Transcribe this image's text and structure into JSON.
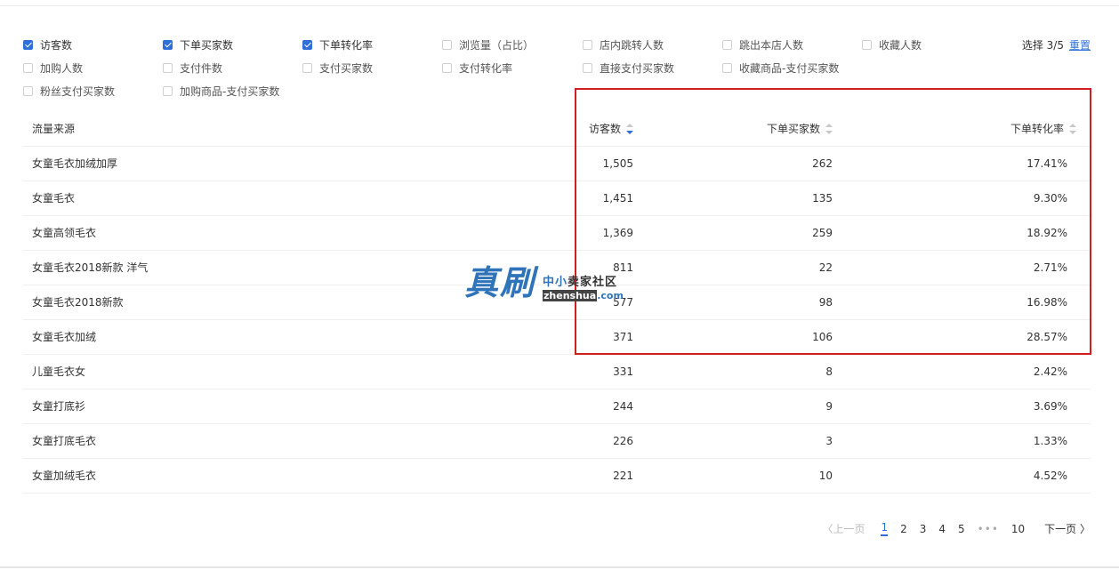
{
  "filters": {
    "row1": [
      {
        "label": "访客数",
        "checked": true
      },
      {
        "label": "下单买家数",
        "checked": true
      },
      {
        "label": "下单转化率",
        "checked": true
      },
      {
        "label": "浏览量（占比）",
        "checked": false
      },
      {
        "label": "店内跳转人数",
        "checked": false
      },
      {
        "label": "跳出本店人数",
        "checked": false
      },
      {
        "label": "收藏人数",
        "checked": false
      }
    ],
    "row2": [
      {
        "label": "加购人数",
        "checked": false
      },
      {
        "label": "支付件数",
        "checked": false
      },
      {
        "label": "支付买家数",
        "checked": false
      },
      {
        "label": "支付转化率",
        "checked": false
      },
      {
        "label": "直接支付买家数",
        "checked": false
      },
      {
        "label": "收藏商品-支付买家数",
        "checked": false
      }
    ],
    "row3": [
      {
        "label": "粉丝支付买家数",
        "checked": false
      },
      {
        "label": "加购商品-支付买家数",
        "checked": false
      }
    ],
    "selection_text": "选择 3/5",
    "reset_label": "重置"
  },
  "table": {
    "headers": {
      "source": "流量来源",
      "visitors": "访客数",
      "buyers": "下单买家数",
      "rate": "下单转化率"
    },
    "rows": [
      {
        "source": "女童毛衣加绒加厚",
        "visitors": "1,505",
        "buyers": "262",
        "rate": "17.41%"
      },
      {
        "source": "女童毛衣",
        "visitors": "1,451",
        "buyers": "135",
        "rate": "9.30%"
      },
      {
        "source": "女童高领毛衣",
        "visitors": "1,369",
        "buyers": "259",
        "rate": "18.92%"
      },
      {
        "source": "女童毛衣2018新款 洋气",
        "visitors": "811",
        "buyers": "22",
        "rate": "2.71%"
      },
      {
        "source": "女童毛衣2018新款",
        "visitors": "577",
        "buyers": "98",
        "rate": "16.98%"
      },
      {
        "source": "女童毛衣加绒",
        "visitors": "371",
        "buyers": "106",
        "rate": "28.57%"
      },
      {
        "source": "儿童毛衣女",
        "visitors": "331",
        "buyers": "8",
        "rate": "2.42%"
      },
      {
        "source": "女童打底衫",
        "visitors": "244",
        "buyers": "9",
        "rate": "3.69%"
      },
      {
        "source": "女童打底毛衣",
        "visitors": "226",
        "buyers": "3",
        "rate": "1.33%"
      },
      {
        "source": "女童加绒毛衣",
        "visitors": "221",
        "buyers": "10",
        "rate": "4.52%"
      }
    ]
  },
  "watermark": {
    "main": "真刷",
    "cn_a": "中小",
    "cn_b": "卖家社区",
    "en_a": "zhenshua",
    "en_b": ".com"
  },
  "pagination": {
    "prev": "〈上一页",
    "pages": [
      "1",
      "2",
      "3",
      "4",
      "5"
    ],
    "dots": "•••",
    "last": "10",
    "next": "下一页 〉",
    "current": "1"
  },
  "colors": {
    "accent": "#2f6fd6",
    "highlight": "#d11f1f"
  }
}
